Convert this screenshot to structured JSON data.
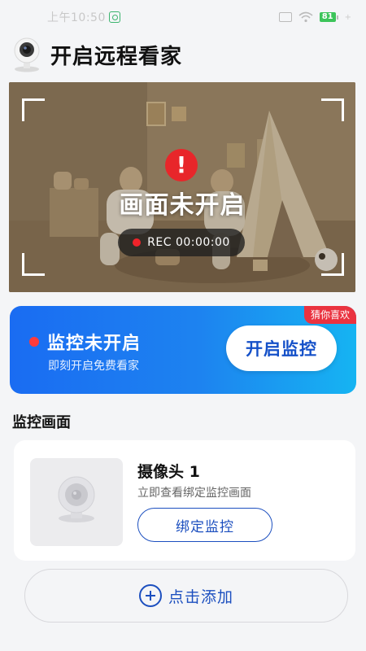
{
  "status_bar": {
    "time": "上午10:50",
    "battery": "81"
  },
  "header": {
    "title": "开启远程看家"
  },
  "hero": {
    "status_text": "画面未开启",
    "rec_label": "REC 00:00:00"
  },
  "promo": {
    "tag": "猜你喜欢",
    "title": "监控未开启",
    "subtitle": "即刻开启免费看家",
    "button_label": "开启监控"
  },
  "section": {
    "title": "监控画面"
  },
  "camera": {
    "name": "摄像头 1",
    "description": "立即查看绑定监控画面",
    "bind_label": "绑定监控"
  },
  "add": {
    "label": "点击添加"
  },
  "colors": {
    "accent": "#1c4fbf",
    "promo_gradient_start": "#1a6cf2",
    "promo_gradient_end": "#16b4f2",
    "alert_red": "#e8262a",
    "tag_red": "#ea3340"
  },
  "icons": {
    "header": "security-camera-icon",
    "hero_alert": "exclamation-icon",
    "add": "plus-circle-icon"
  }
}
